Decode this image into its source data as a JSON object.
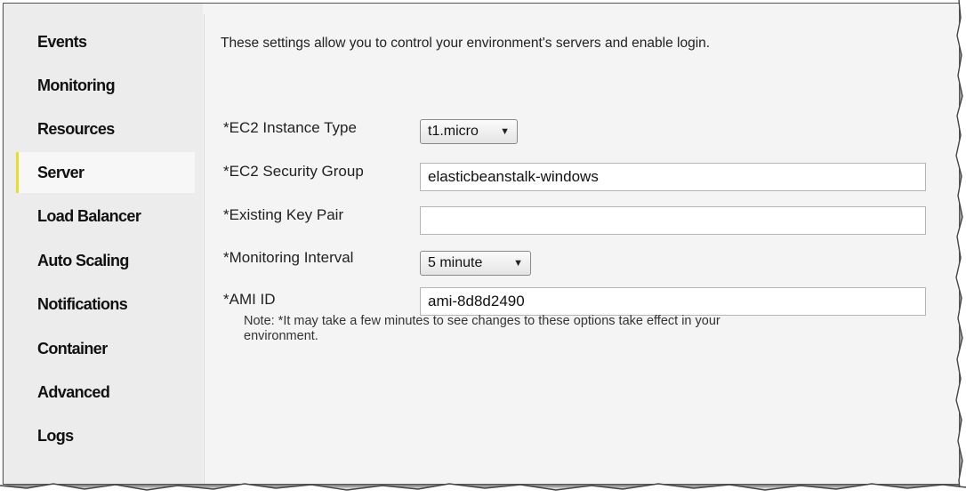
{
  "sidebar": {
    "items": [
      {
        "label": "Events"
      },
      {
        "label": "Monitoring"
      },
      {
        "label": "Resources"
      },
      {
        "label": "Server"
      },
      {
        "label": "Load Balancer"
      },
      {
        "label": "Auto Scaling"
      },
      {
        "label": "Notifications"
      },
      {
        "label": "Container"
      },
      {
        "label": "Advanced"
      },
      {
        "label": "Logs"
      }
    ],
    "selected": "Server",
    "selected_accent_color": "#e8de2a"
  },
  "main": {
    "intro": "These settings allow you to control your environment's servers and enable login.",
    "fields": {
      "instance_type": {
        "label": "*EC2 Instance Type",
        "value": "t1.micro"
      },
      "security_group": {
        "label": "*EC2 Security Group",
        "value": "elasticbeanstalk-windows"
      },
      "key_pair": {
        "label": "*Existing Key Pair",
        "value": ""
      },
      "monitoring_interval": {
        "label": "*Monitoring Interval",
        "value": "5 minute"
      },
      "ami_id": {
        "label": "*AMI ID",
        "value": "ami-8d8d2490"
      }
    },
    "note": "Note: *It may take a few minutes to see changes to these options take effect in your environment.",
    "dropdown_caret": "▼"
  }
}
